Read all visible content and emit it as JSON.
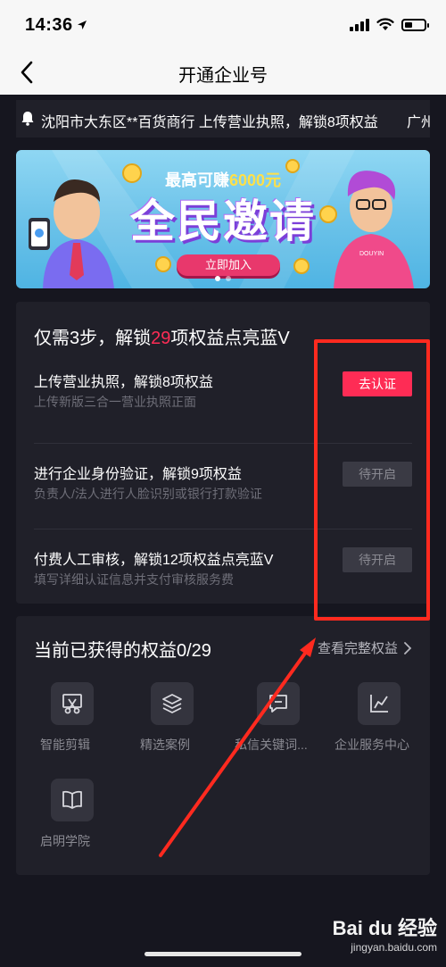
{
  "status_bar": {
    "time": "14:36"
  },
  "nav": {
    "title": "开通企业号"
  },
  "notice": {
    "text": "沈阳市大东区**百货商行  上传营业执照，解锁8项权益",
    "text_next": "广州*"
  },
  "banner": {
    "subtitle_prefix": "最高可赚",
    "subtitle_amount": "6000元",
    "title": "全民邀请",
    "button": "立即加入",
    "brand_tag": "DOUYIN"
  },
  "steps": {
    "title_prefix": "仅需3步，解锁",
    "title_number": "29",
    "title_suffix": "项权益点亮蓝V",
    "items": [
      {
        "name": "上传营业执照，解锁8项权益",
        "desc": "上传新版三合一营业执照正面",
        "action": "去认证"
      },
      {
        "name": "进行企业身份验证，解锁9项权益",
        "desc": "负责人/法人进行人脸识别或银行打款验证",
        "action": "待开启"
      },
      {
        "name": "付费人工审核，解锁12项权益点亮蓝V",
        "desc": "填写详细认证信息并支付审核服务费",
        "action": "待开启"
      }
    ]
  },
  "benefits": {
    "title": "当前已获得的权益0/29",
    "link": "查看完整权益",
    "items": [
      {
        "label": "智能剪辑",
        "icon": "scissors-icon"
      },
      {
        "label": "精选案例",
        "icon": "layers-icon"
      },
      {
        "label": "私信关键词...",
        "icon": "message-icon"
      },
      {
        "label": "企业服务中心",
        "icon": "chart-icon"
      },
      {
        "label": "启明学院",
        "icon": "book-icon"
      }
    ]
  },
  "watermark": {
    "logo": "Bai du 经验",
    "url": "jingyan.baidu.com"
  },
  "colors": {
    "accent": "#fe2c55",
    "background": "#16161f",
    "card": "#202029",
    "annotation": "#ff2a1f"
  }
}
